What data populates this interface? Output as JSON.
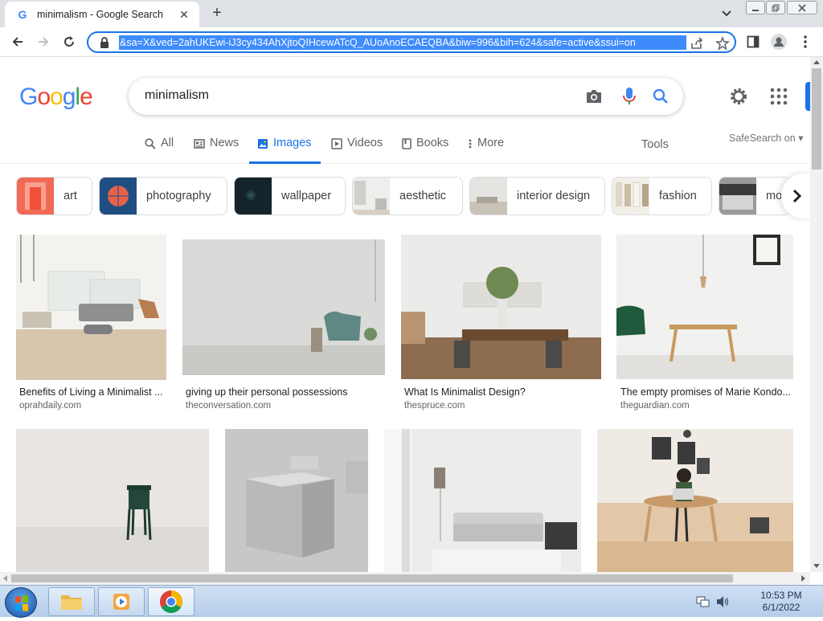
{
  "browser": {
    "tab_title": "minimalism - Google Search",
    "url": "&sa=X&ved=2ahUKEwi-iJ3cy434AhXjtoQIHcewATcQ_AUoAnoECAEQBA&biw=996&bih=624&safe=active&ssui=on"
  },
  "search": {
    "logo": [
      "G",
      "o",
      "o",
      "g",
      "l",
      "e"
    ],
    "query": "minimalism"
  },
  "tabs": [
    {
      "label": "All",
      "icon": "search-icon"
    },
    {
      "label": "News",
      "icon": "news-icon"
    },
    {
      "label": "Images",
      "icon": "image-icon",
      "active": true
    },
    {
      "label": "Videos",
      "icon": "play-icon"
    },
    {
      "label": "Books",
      "icon": "book-icon"
    },
    {
      "label": "More",
      "icon": "more-vert-icon"
    }
  ],
  "tools_label": "Tools",
  "safesearch_label": "SafeSearch on",
  "chips": [
    "art",
    "photography",
    "wallpaper",
    "aesthetic",
    "interior design",
    "fashion",
    "mo"
  ],
  "results": [
    {
      "caption": "Benefits of Living a Minimalist ...",
      "source": "oprahdaily.com"
    },
    {
      "caption": "giving up their personal possessions",
      "source": "theconversation.com"
    },
    {
      "caption": "What Is Minimalist Design?",
      "source": "thespruce.com"
    },
    {
      "caption": "The empty promises of Marie Kondo...",
      "source": "theguardian.com"
    },
    {
      "caption": "",
      "source": ""
    },
    {
      "caption": "",
      "source": ""
    },
    {
      "caption": "",
      "source": ""
    },
    {
      "caption": "",
      "source": ""
    }
  ],
  "taskbar": {
    "time": "10:53 PM",
    "date": "6/1/2022"
  },
  "colors": {
    "accent": "#1a73e8",
    "url_selection": "#3d8bfd"
  }
}
